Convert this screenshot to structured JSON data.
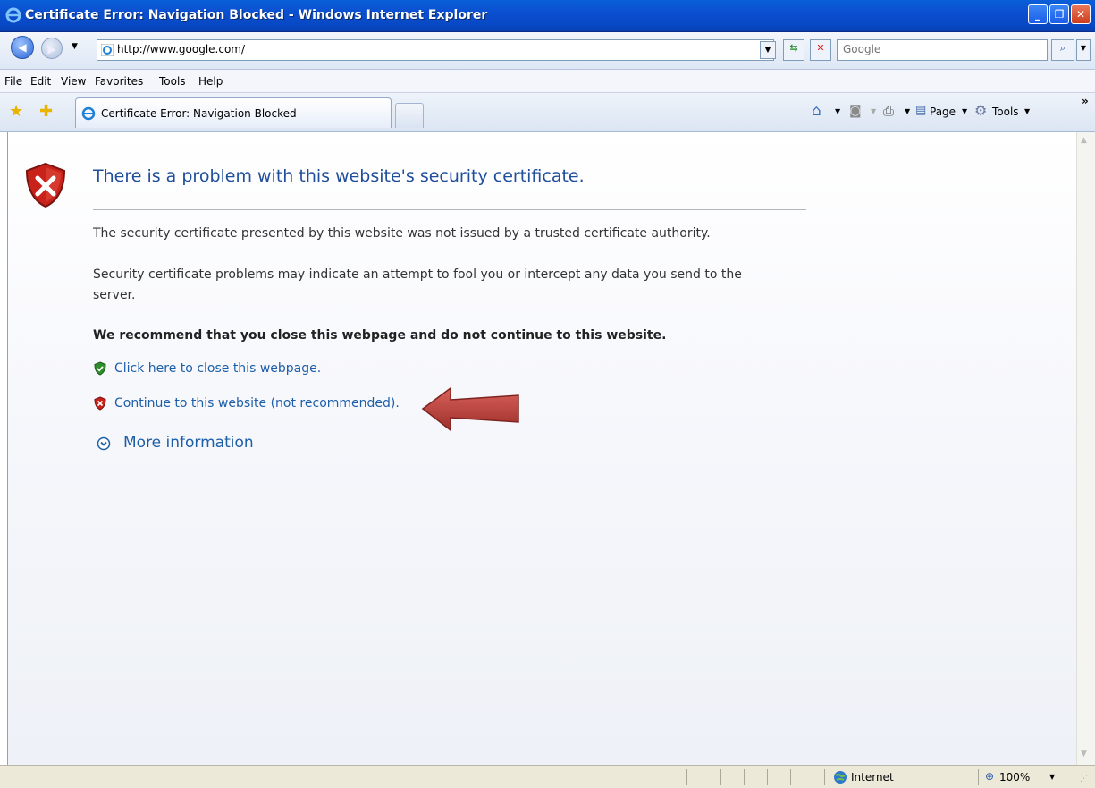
{
  "window": {
    "title": "Certificate Error: Navigation Blocked - Windows Internet Explorer",
    "minimize": "_",
    "maximize": "❐",
    "close": "✕"
  },
  "address": {
    "url": "http://www.google.com/",
    "search_placeholder": "Google"
  },
  "menu": [
    "File",
    "Edit",
    "View",
    "Favorites",
    "Tools",
    "Help"
  ],
  "tab": {
    "title": "Certificate Error: Navigation Blocked"
  },
  "toolbar": {
    "page_label": "Page",
    "tools_label": "Tools",
    "overflow": "»"
  },
  "page": {
    "heading": "There is a problem with this website's security certificate.",
    "para1": "The security certificate presented by this website was not issued by a trusted certificate authority.",
    "para2": "Security certificate problems may indicate an attempt to fool you or intercept any data you send to the server.",
    "recommend": "We recommend that you close this webpage and do not continue to this website.",
    "close_link": "Click here to close this webpage.",
    "continue_link": "Continue to this website (not recommended).",
    "more_info": "More information"
  },
  "status": {
    "zone": "Internet",
    "zoom": "100%"
  },
  "colors": {
    "titlebar": "#0b4fd0",
    "heading": "#1f4e9b",
    "link": "#1d5ea8",
    "arrow": "#b5413c"
  }
}
